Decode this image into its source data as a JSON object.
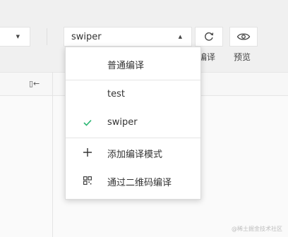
{
  "toolbar": {
    "mode_select_value": "swiper",
    "compile_label": "编译",
    "preview_label": "预览"
  },
  "dropdown": {
    "items": [
      {
        "label": "普通编译",
        "icon": "none",
        "selected": false
      },
      {
        "label": "test",
        "icon": "none",
        "selected": false
      },
      {
        "label": "swiper",
        "icon": "check-icon",
        "selected": true
      },
      {
        "label": "添加编译模式",
        "icon": "plus-icon",
        "selected": false
      },
      {
        "label": "通过二维码编译",
        "icon": "qr-code-icon",
        "selected": false
      }
    ]
  },
  "watermark": "@稀土掘金技术社区",
  "colors": {
    "check": "#2bb673",
    "text": "#333333",
    "border": "#e3e3e3"
  }
}
